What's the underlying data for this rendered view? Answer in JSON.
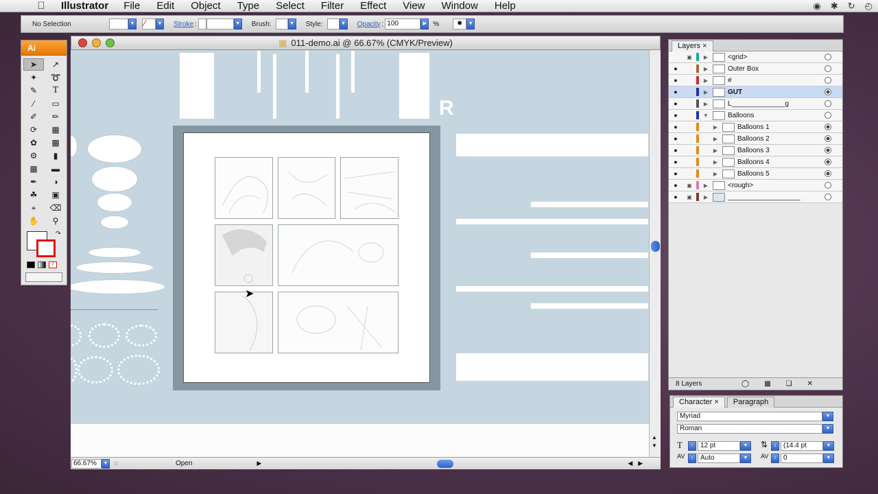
{
  "menubar": {
    "app_name": "Illustrator",
    "items": [
      "File",
      "Edit",
      "Object",
      "Type",
      "Select",
      "Filter",
      "Effect",
      "View",
      "Window",
      "Help"
    ]
  },
  "controlbar": {
    "selection": "No Selection",
    "stroke_label": "Stroke",
    "brush_label": "Brush:",
    "style_label": "Style:",
    "opacity_label": "Opacity",
    "opacity_value": "100",
    "percent": "%"
  },
  "tools": {
    "logo": "Ai"
  },
  "document": {
    "title": "011-demo.ai @ 66.67% (CMYK/Preview)",
    "canvas_letter": "R",
    "zoom": "66.67%",
    "status": "Open"
  },
  "layers_panel": {
    "tab": "Layers",
    "count": "8 Layers",
    "layers": [
      {
        "name": "<grid>",
        "color": "#1fa9a0"
      },
      {
        "name": "Outer Box",
        "color": "#a86a2e"
      },
      {
        "name": "#",
        "color": "#d02a2a"
      },
      {
        "name": "GUT",
        "color": "#2233a6"
      },
      {
        "name": "L______________g",
        "color": "#555555"
      },
      {
        "name": "Balloons",
        "color": "#2233a6"
      },
      {
        "name": "Balloons 1",
        "color": "#e08a1a"
      },
      {
        "name": "Balloons 2",
        "color": "#e08a1a"
      },
      {
        "name": "Balloons 3",
        "color": "#e08a1a"
      },
      {
        "name": "Balloons 4",
        "color": "#e08a1a"
      },
      {
        "name": "Balloons 5",
        "color": "#e08a1a"
      },
      {
        "name": "<rough>",
        "color": "#e07aa8"
      },
      {
        "name": "___________________",
        "color": "#7a3d2a"
      }
    ]
  },
  "character_panel": {
    "tabs": [
      "Character",
      "Paragraph"
    ],
    "font_family": "Myriad",
    "font_style": "Roman",
    "font_size": "12 pt",
    "leading": "(14.4 pt",
    "kerning": "Auto",
    "tracking": "0"
  }
}
